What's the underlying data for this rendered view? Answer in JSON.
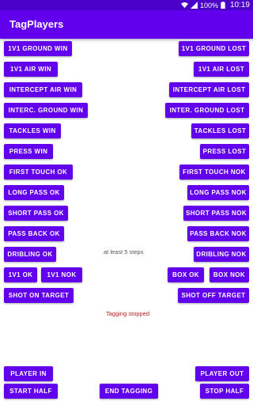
{
  "status_bar": {
    "battery_percent": "100%",
    "time": "10:19",
    "icons": [
      "wifi-icon",
      "signal-icon",
      "battery-icon"
    ]
  },
  "app_bar": {
    "title": "TagPlayers"
  },
  "buttons": {
    "ground_win": "1V1 GROUND WIN",
    "ground_lost": "1V1 GROUND LOST",
    "air_win": "1V1 AIR WIN",
    "air_lost": "1V1 AIR LOST",
    "intercept_air_win": "INTERCEPT AIR WIN",
    "intercept_air_lost": "INTERCEPT AIR LOST",
    "interc_ground_win": "INTERC. GROUND WIN",
    "inter_ground_lost": "INTER. GROUND LOST",
    "tackles_win": "TACKLES WIN",
    "tackles_lost": "TACKLES LOST",
    "press_win": "PRESS WIN",
    "press_lost": "PRESS LOST",
    "first_touch_ok": "FIRST TOUCH OK",
    "first_touch_nok": "FIRST TOUCH NOK",
    "long_pass_ok": "LONG PASS OK",
    "long_pass_nok": "LONG PASS NOK",
    "short_pass_ok": "SHORT PASS OK",
    "short_pass_nok": "SHORT PASS NOK",
    "pass_back_ok": "PASS BACK OK",
    "pass_back_nok": "PASS BACK NOK",
    "dribling_ok": "DRIBLING OK",
    "dribling_nok": "DRIBLING NOK",
    "v1_ok": "1V1 OK",
    "v1_nok": "1V1 NOK",
    "box_ok": "BOX OK",
    "box_nok": "BOX NOK",
    "shot_on_target": "SHOT ON TARGET",
    "shot_off_target": "SHOT OFF TARGET",
    "player_in": "PLAYER IN",
    "player_out": "PLAYER OUT",
    "start_half": "START HALF",
    "end_tagging": "END TAGGING",
    "stop_half": "STOP HALF"
  },
  "messages": {
    "steps_hint": "at least 5 steps",
    "tagging_status": "Tagging stopped"
  },
  "colors": {
    "primary": "#6200ee",
    "status_bar": "#4a00c9",
    "hint_text": "#555555",
    "status_text": "#b22222"
  }
}
